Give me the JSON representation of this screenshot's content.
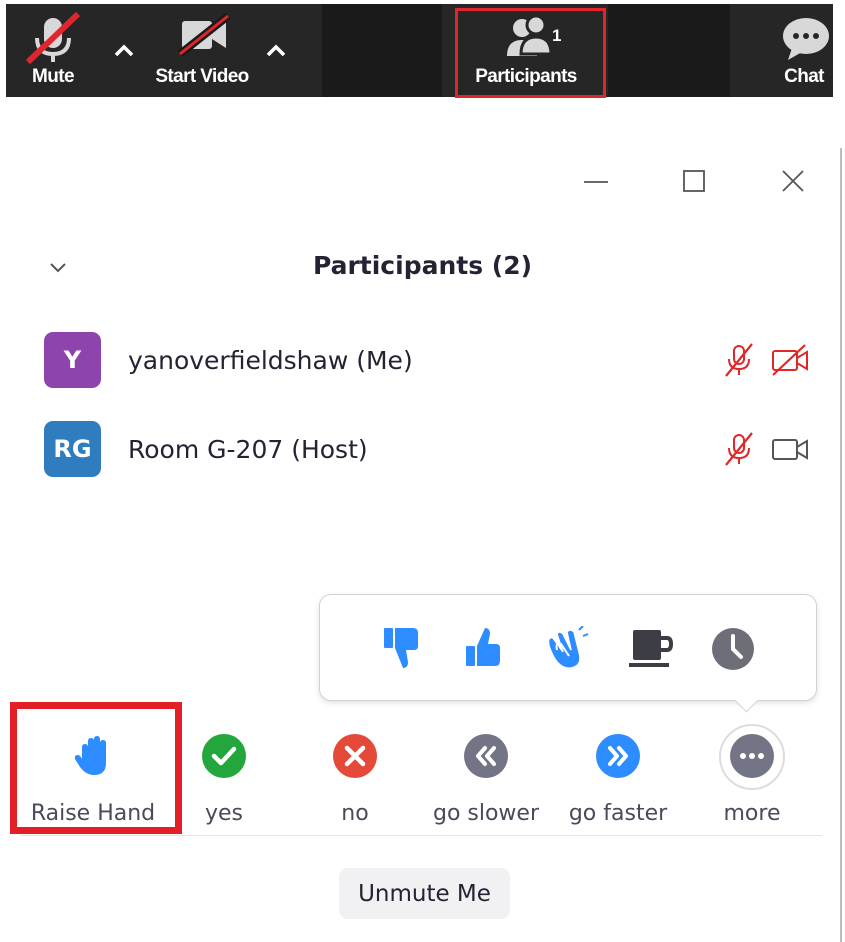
{
  "toolbar": {
    "mute_label": "Mute",
    "start_video_label": "Start Video",
    "participants_label": "Participants",
    "participants_count": "1",
    "chat_label": "Chat"
  },
  "panel": {
    "title": "Participants (2)",
    "participants": [
      {
        "initials": "Y",
        "name": "yanoverfieldshaw (Me)",
        "avatar_color": "#8e44ad",
        "muted": true,
        "video_off": true
      },
      {
        "initials": "RG",
        "name": "Room G-207 (Host)",
        "avatar_color": "#2f7dbf",
        "muted": true,
        "video_off": false
      }
    ]
  },
  "reactions": [
    "thumbs-down",
    "thumbs-up",
    "clap",
    "coffee",
    "clock"
  ],
  "feedback": {
    "raise_hand": "Raise Hand",
    "yes": "yes",
    "no": "no",
    "go_slower": "go slower",
    "go_faster": "go faster",
    "more": "more"
  },
  "unmute_label": "Unmute Me",
  "colors": {
    "accent_blue": "#2d8cff",
    "mute_red": "#e02828",
    "yes_green": "#23a63c",
    "no_red": "#e5493a",
    "neutral_gray": "#747487",
    "highlight_red": "#e21f26"
  }
}
